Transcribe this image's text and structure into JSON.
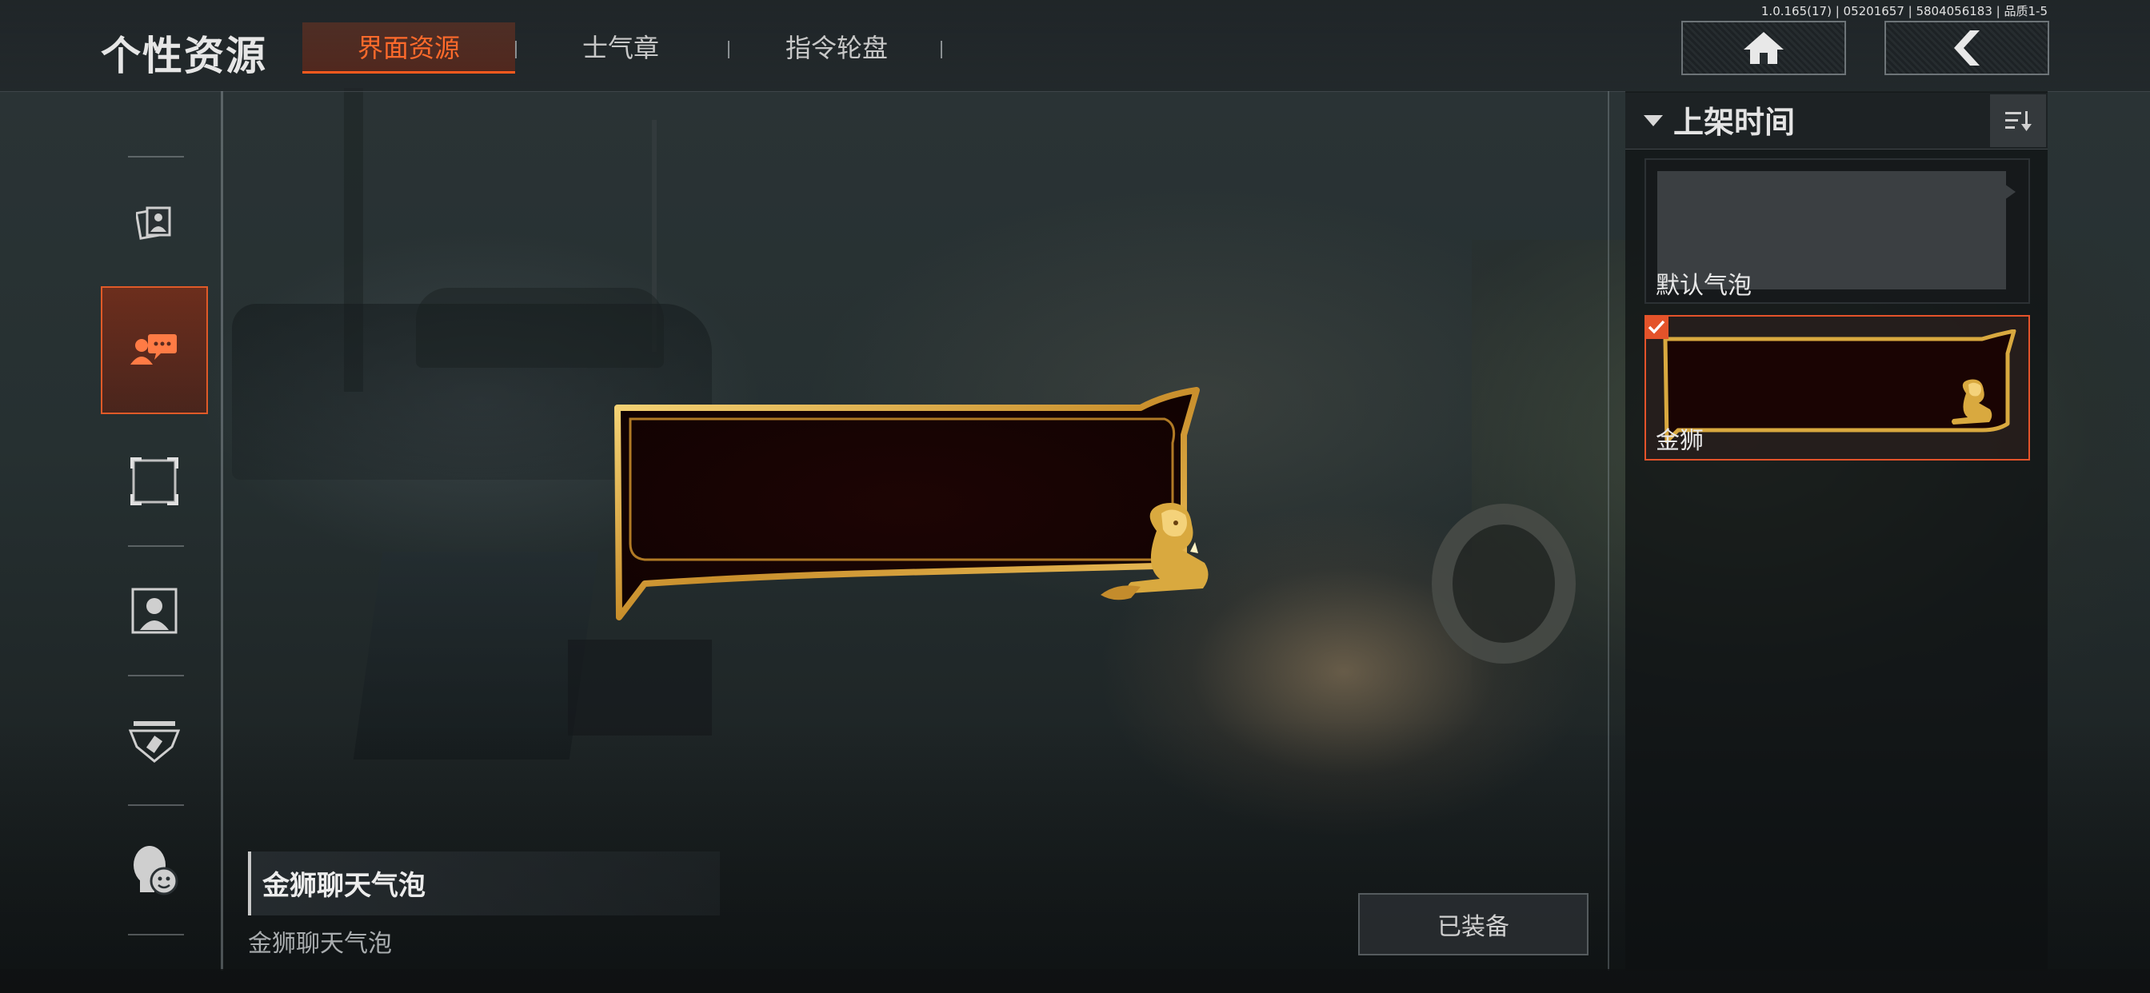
{
  "header": {
    "title": "个性资源",
    "version": "1.0.165(17) | 05201657 | 5804056183 | 品质1-5",
    "tabs": [
      {
        "label": "界面资源",
        "active": true
      },
      {
        "label": "士气章",
        "active": false
      },
      {
        "label": "指令轮盘",
        "active": false
      }
    ],
    "home_icon": "home-icon",
    "back_icon": "back-arrow-icon"
  },
  "sidebar": {
    "items": [
      {
        "icon": "photo-cards-icon",
        "active": false
      },
      {
        "icon": "chat-bubble-user-icon",
        "active": true
      },
      {
        "icon": "avatar-frame-icon",
        "active": false
      },
      {
        "icon": "portrait-icon",
        "active": false
      },
      {
        "icon": "badge-emblem-icon",
        "active": false
      },
      {
        "icon": "emote-head-icon",
        "active": false
      }
    ]
  },
  "preview": {
    "item_name": "金狮聊天气泡",
    "item_description": "金狮聊天气泡",
    "equip_button": "已装备"
  },
  "list": {
    "sort_label": "上架时间",
    "sort_icon": "sort-order-icon",
    "items": [
      {
        "label": "默认气泡",
        "selected": false
      },
      {
        "label": "金狮",
        "selected": true
      }
    ]
  },
  "colors": {
    "accent": "#ff5a1e",
    "gold": "#d9a93f",
    "bubble_fill": "#1a0403"
  }
}
